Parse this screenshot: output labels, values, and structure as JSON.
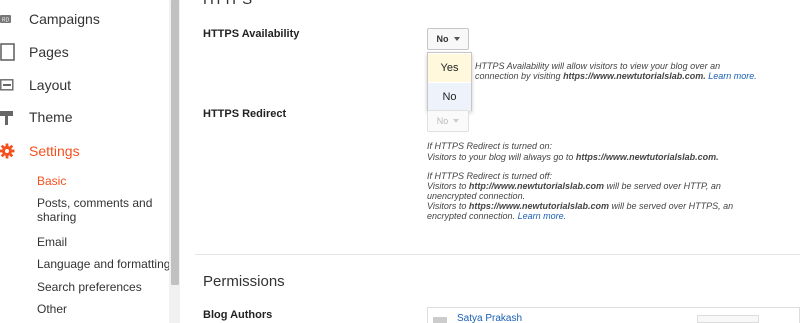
{
  "sidebar": {
    "items": [
      {
        "label": "Campaigns",
        "icon": "campaigns-icon"
      },
      {
        "label": "Pages",
        "icon": "pages-icon"
      },
      {
        "label": "Layout",
        "icon": "layout-icon"
      },
      {
        "label": "Theme",
        "icon": "theme-icon"
      },
      {
        "label": "Settings",
        "icon": "gear-icon",
        "active": true
      }
    ],
    "sub_items": [
      {
        "label": "Basic",
        "active": true
      },
      {
        "label": "Posts, comments and sharing"
      },
      {
        "label": "Email"
      },
      {
        "label": "Language and formatting"
      },
      {
        "label": "Search preferences"
      },
      {
        "label": "Other"
      }
    ]
  },
  "main": {
    "https_title": "HTTPS",
    "https_availability": {
      "label": "HTTPS Availability",
      "value": "No",
      "options": [
        "Yes",
        "No"
      ],
      "help_pre": "HTTPS Availability will allow visitors to view your blog over an",
      "help_mid": "connection by visiting ",
      "help_url": "https://www.newtutorialslab.com.",
      "help_link": "Learn more."
    },
    "https_redirect": {
      "label": "HTTPS Redirect",
      "value": "No",
      "on_line1": "If HTTPS Redirect is turned on:",
      "on_line2_pre": "Visitors to your blog will always go to ",
      "on_line2_url": "https://www.newtutorialslab.com.",
      "off_line1": "If HTTPS Redirect is turned off:",
      "off_line2_pre": "Visitors to ",
      "off_line2_url": "http://www.newtutorialslab.com",
      "off_line2_post": " will be served over HTTP, an",
      "off_line3": "unencrypted connection.",
      "off_line4_pre": "Visitors to ",
      "off_line4_url": "https://www.newtutorialslab.com",
      "off_line4_post": " will be served over HTTPS, an",
      "off_line5_pre": "encrypted connection. ",
      "off_line5_link": "Learn more."
    },
    "permissions_title": "Permissions",
    "blog_authors": {
      "label": "Blog Authors",
      "author_name": "Satya Prakash"
    }
  },
  "colors": {
    "accent": "#f4511e",
    "link": "#1a5fb4",
    "selected_option_bg": "#fff8dc",
    "hover_option_bg": "#eef3fb"
  }
}
